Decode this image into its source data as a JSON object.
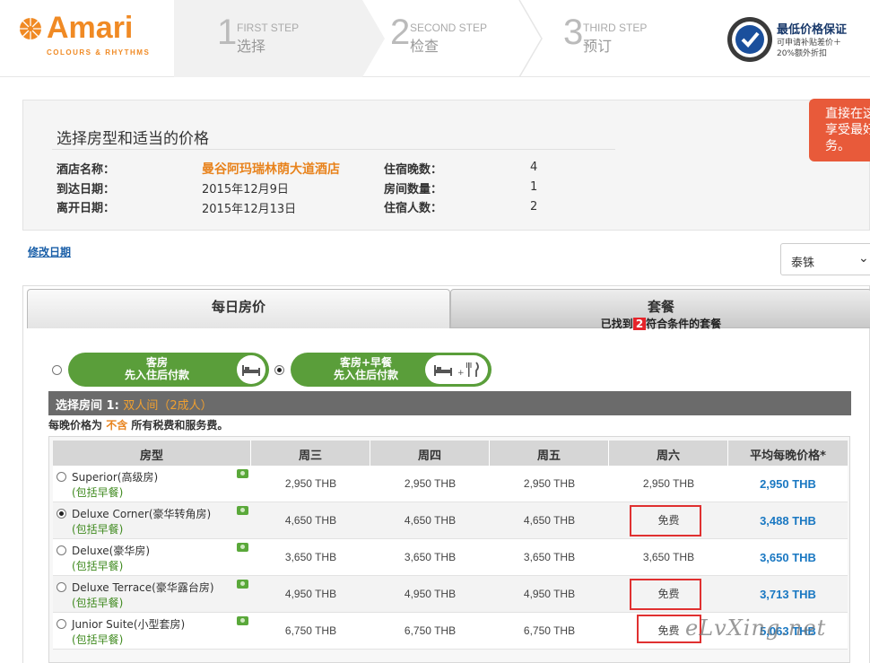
{
  "header": {
    "logo": {
      "brand": "Amari",
      "tagline": "COLOURS & RHYTHMS"
    },
    "steps": [
      {
        "num": "1",
        "en": "FIRST STEP",
        "zh": "选择"
      },
      {
        "num": "2",
        "en": "SECOND STEP",
        "zh": "检查"
      },
      {
        "num": "3",
        "en": "THIRD STEP",
        "zh": "预订"
      }
    ],
    "guarantee": {
      "title": "最低价格保证",
      "line1": "可申请补贴差价＋",
      "line2": "20%额外折扣"
    }
  },
  "info": {
    "title": "选择房型和适当的价格",
    "hotel_label": "酒店名称：",
    "hotel_name": "曼谷阿玛瑞林荫大道酒店",
    "arrival_label": "到达日期：",
    "arrival_date": "2015年12月9日",
    "depart_label": "离开日期：",
    "depart_date": "2015年12月13日",
    "nights_label": "住宿晚数：",
    "nights": "4",
    "rooms_label": "房间数量：",
    "rooms": "1",
    "guests_label": "住宿人数：",
    "guests": "2"
  },
  "cta": {
    "text1": "直接在这",
    "text2": "享受最好",
    "text3": "务。"
  },
  "modify_link": "修改日期",
  "currency": {
    "value": "泰铢"
  },
  "tabs": {
    "daily": "每日房价",
    "package": "套餐",
    "package_sub_prefix": "已找到",
    "package_count": "2",
    "package_sub_suffix": "符合条件的套餐"
  },
  "options": [
    {
      "line1": "客房",
      "line2": "先入住后付款",
      "selected": false
    },
    {
      "line1": "客房+早餐",
      "line2": "先入住后付款",
      "selected": true
    }
  ],
  "section": {
    "prefix": "选择房间 1:",
    "selection": "双人间（2成人）",
    "tax_prefix": "每晚价格为",
    "tax_highlight": "不含",
    "tax_suffix": "所有税费和服务费。"
  },
  "table": {
    "headers": [
      "房型",
      "周三",
      "周四",
      "周五",
      "周六",
      "平均每晚价格*"
    ],
    "rows": [
      {
        "name": "Superior(高级房)",
        "sub": "(包括早餐)",
        "prices": [
          "2,950 THB",
          "2,950 THB",
          "2,950 THB",
          "2,950 THB"
        ],
        "avg": "2,950 THB",
        "selected": false
      },
      {
        "name": "Deluxe Corner(豪华转角房)",
        "sub": "(包括早餐)",
        "prices": [
          "4,650 THB",
          "4,650 THB",
          "4,650 THB",
          "免费"
        ],
        "avg": "3,488 THB",
        "selected": true
      },
      {
        "name": "Deluxe(豪华房)",
        "sub": "(包括早餐)",
        "prices": [
          "3,650 THB",
          "3,650 THB",
          "3,650 THB",
          "3,650 THB"
        ],
        "avg": "3,650 THB",
        "selected": false
      },
      {
        "name": "Deluxe Terrace(豪华露台房)",
        "sub": "(包括早餐)",
        "prices": [
          "4,950 THB",
          "4,950 THB",
          "4,950 THB",
          "免费"
        ],
        "avg": "3,713 THB",
        "selected": false
      },
      {
        "name": "Junior Suite(小型套房)",
        "sub": "(包括早餐)",
        "prices": [
          "6,750 THB",
          "6,750 THB",
          "6,750 THB",
          "免费"
        ],
        "avg": "5,063 THB",
        "selected": false
      }
    ]
  },
  "watermark": "eLvXing.net",
  "colors": {
    "brand": "#f08a24",
    "green": "#5a9e3a",
    "link": "#1a78c2",
    "highlight_box": "#e03030"
  }
}
